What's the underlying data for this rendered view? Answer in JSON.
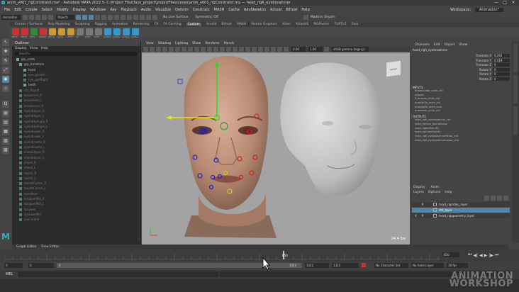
{
  "window": {
    "title": "anim_v001_rigConstraint.ma* - Autodesk MAYA 2022.5: C:\\Project Files\\face_project\\projectFile\\scenes\\anim_v001_rigConstraint.ma --- head_rigR_eyebrowInner",
    "controls": [
      "—",
      "□",
      "✕"
    ]
  },
  "menubar": [
    "File",
    "Edit",
    "Create",
    "Select",
    "Modify",
    "Display",
    "Windows",
    "Key",
    "Playback",
    "Audio",
    "Visualize",
    "Deform",
    "Constrain",
    "MASH",
    "Cache",
    "AdvSkeleton",
    "Arnold",
    "Bifrost",
    "Help"
  ],
  "menubar_right": {
    "workspace_label": "Workspace:",
    "workspace_value": "Animation*"
  },
  "statusline": {
    "mode": "Animation",
    "objects": "Objects",
    "no_live_surface": "No Live Surface",
    "symmetry": "Symmetry: Off",
    "user": "Madhav Shyam"
  },
  "shelf": {
    "tabs": [
      "Curves / Surfaces",
      "Poly Modeling",
      "Sculpting",
      "Rigging",
      "Animation",
      "Rendering",
      "FX",
      "FX Caching",
      "Custom",
      "Arnold",
      "Bifrost",
      "MASH",
      "Motion Graphics",
      "XGen",
      "XGenUS",
      "MGPacker",
      "TURTLE",
      "Zelo"
    ],
    "active": "Custom",
    "icons": [
      "dfEnb",
      "dfEnb",
      "zTDe",
      "ikDelet",
      "pBrTg",
      "pwTg",
      "pfxTg",
      "CE",
      "CVM",
      "PVM",
      "parBay",
      "parBay",
      "parBay",
      "parBay"
    ]
  },
  "toolbox": [
    "↖",
    "✥",
    "↻",
    "⤢",
    "▣",
    "◇",
    "Q",
    "▤",
    "▥",
    "▦",
    "▧",
    "▨"
  ],
  "outliner": {
    "title": "Outliner",
    "menu": [
      "Display",
      "Show",
      "Help"
    ],
    "search_placeholder": "Search...",
    "items": [
      {
        "label": "grp_scale",
        "indent": 6,
        "dim": false
      },
      {
        "label": "grp_transform",
        "indent": 10,
        "dim": false
      },
      {
        "label": "head",
        "indent": 16,
        "dim": false
      },
      {
        "label": "eye_geoleft",
        "indent": 16,
        "dim": true
      },
      {
        "label": "eye_geoRight",
        "indent": 16,
        "dim": true
      },
      {
        "label": "teeth",
        "indent": 16,
        "dim": false
      },
      {
        "label": "ctrl_RigidR",
        "indent": 10,
        "dim": true
      },
      {
        "label": "browInner_R",
        "indent": 10,
        "dim": true
      },
      {
        "label": "browOuter_L",
        "indent": 10,
        "dim": true
      },
      {
        "label": "browInnerL_R",
        "indent": 10,
        "dim": true
      },
      {
        "label": "eyelidUpper_R",
        "indent": 10,
        "dim": true
      },
      {
        "label": "eyelidUpper_L",
        "indent": 10,
        "dim": true
      },
      {
        "label": "eyelidUpAngle_R",
        "indent": 10,
        "dim": true
      },
      {
        "label": "eyelidUpAngle_L",
        "indent": 10,
        "dim": true
      },
      {
        "label": "eyelidLower_R",
        "indent": 10,
        "dim": true
      },
      {
        "label": "eyelidLower_L",
        "indent": 10,
        "dim": true
      },
      {
        "label": "eyelidLowAn_R",
        "indent": 10,
        "dim": true
      },
      {
        "label": "eyelidLowAn_L",
        "indent": 10,
        "dim": true
      },
      {
        "label": "cheekUpper_R",
        "indent": 10,
        "dim": true
      },
      {
        "label": "cheekUpper_L",
        "indent": 10,
        "dim": true
      },
      {
        "label": "cheek_R",
        "indent": 10,
        "dim": true
      },
      {
        "label": "cheek_L",
        "indent": 10,
        "dim": true
      },
      {
        "label": "nostril_R",
        "indent": 10,
        "dim": true
      },
      {
        "label": "nostril_L",
        "indent": 10,
        "dim": true
      },
      {
        "label": "mouthCorner_R",
        "indent": 10,
        "dim": true
      },
      {
        "label": "mouthCorner_L",
        "indent": 10,
        "dim": true
      },
      {
        "label": "noseBase",
        "indent": 10,
        "dim": true
      },
      {
        "label": "lipUpperMid_R",
        "indent": 10,
        "dim": true
      },
      {
        "label": "lipUpperMid_L",
        "indent": 10,
        "dim": true
      },
      {
        "label": "lipLower",
        "indent": 10,
        "dim": true
      },
      {
        "label": "lipLowerMid",
        "indent": 10,
        "dim": true
      },
      {
        "label": "jawControl",
        "indent": 10,
        "dim": true
      }
    ]
  },
  "viewport": {
    "menu": [
      "View",
      "Shading",
      "Lighting",
      "Show",
      "Renderer",
      "Panels"
    ],
    "fields": {
      "value1": "0.00",
      "value2": "1.00",
      "colorspace": "sRGB gamma (legacy)"
    },
    "fps": "24.4 fps",
    "viewcube": "FRONT"
  },
  "channelbox": {
    "tabs": [
      "Channels",
      "Edit",
      "Object",
      "Show"
    ],
    "object": "head_rigR_eyebrowInner",
    "attrs": [
      {
        "label": "Translate X",
        "value": "0.291"
      },
      {
        "label": "Translate Y",
        "value": "0.519"
      },
      {
        "label": "Translate Z",
        "value": "0"
      },
      {
        "label": "Rotate X",
        "value": "0"
      },
      {
        "label": "Rotate Y",
        "value": "0"
      },
      {
        "label": "Rotate Z",
        "value": "0"
      }
    ],
    "inputs_label": "INPUTS",
    "inputs": [
      "browLocator_anim_ctrl",
      "shapes",
      "R_browUp_anim_ctrl",
      "browUpTrs_anim_ctrl",
      "browUpDn_anim_prox",
      "browInner_anim_ctrl"
    ],
    "outputs_label": "OUTPUTS",
    "outputs": [
      "head_rigR_eyebrowInner_ctrl",
      "head_rigOrce_blendShape",
      "head_rigbiblRmult1",
      "head_rigColorConst1",
      "head_rigR_eyebrowInnerRelax_cnd",
      "head_rigR_eyebrowInnerLower_cnd"
    ]
  },
  "layers": {
    "tabs": [
      "Display",
      "Anim"
    ],
    "menu": [
      "Layers",
      "Options",
      "Help"
    ],
    "rows": [
      {
        "v": "",
        "p": "P",
        "name": "head_rig/rdles_layer",
        "selected": false
      },
      {
        "v": "",
        "p": "",
        "name": "ctrl_layer",
        "selected": true
      },
      {
        "v": "V",
        "p": "P",
        "name": "head_rig/geometry_layer",
        "selected": false
      }
    ]
  },
  "bottom": {
    "tabs": [
      "Graph Editor",
      "Time Editor"
    ],
    "current_frame": "850",
    "range_start": "0",
    "range_start2": "0",
    "range_end": "1322",
    "range_end2": "1322",
    "range_field": "1322",
    "frame_field": "850",
    "no_character_set": "No Character Set",
    "no_anim_layer": "No Anim Layer",
    "fps_select": "30 fps",
    "mel_label": "MEL"
  },
  "watermark": {
    "line1": "ANIMATION",
    "line2": "WORKSHOP"
  },
  "colors": {
    "accent": "#5285a6",
    "viewport": "#a3a3a3"
  }
}
